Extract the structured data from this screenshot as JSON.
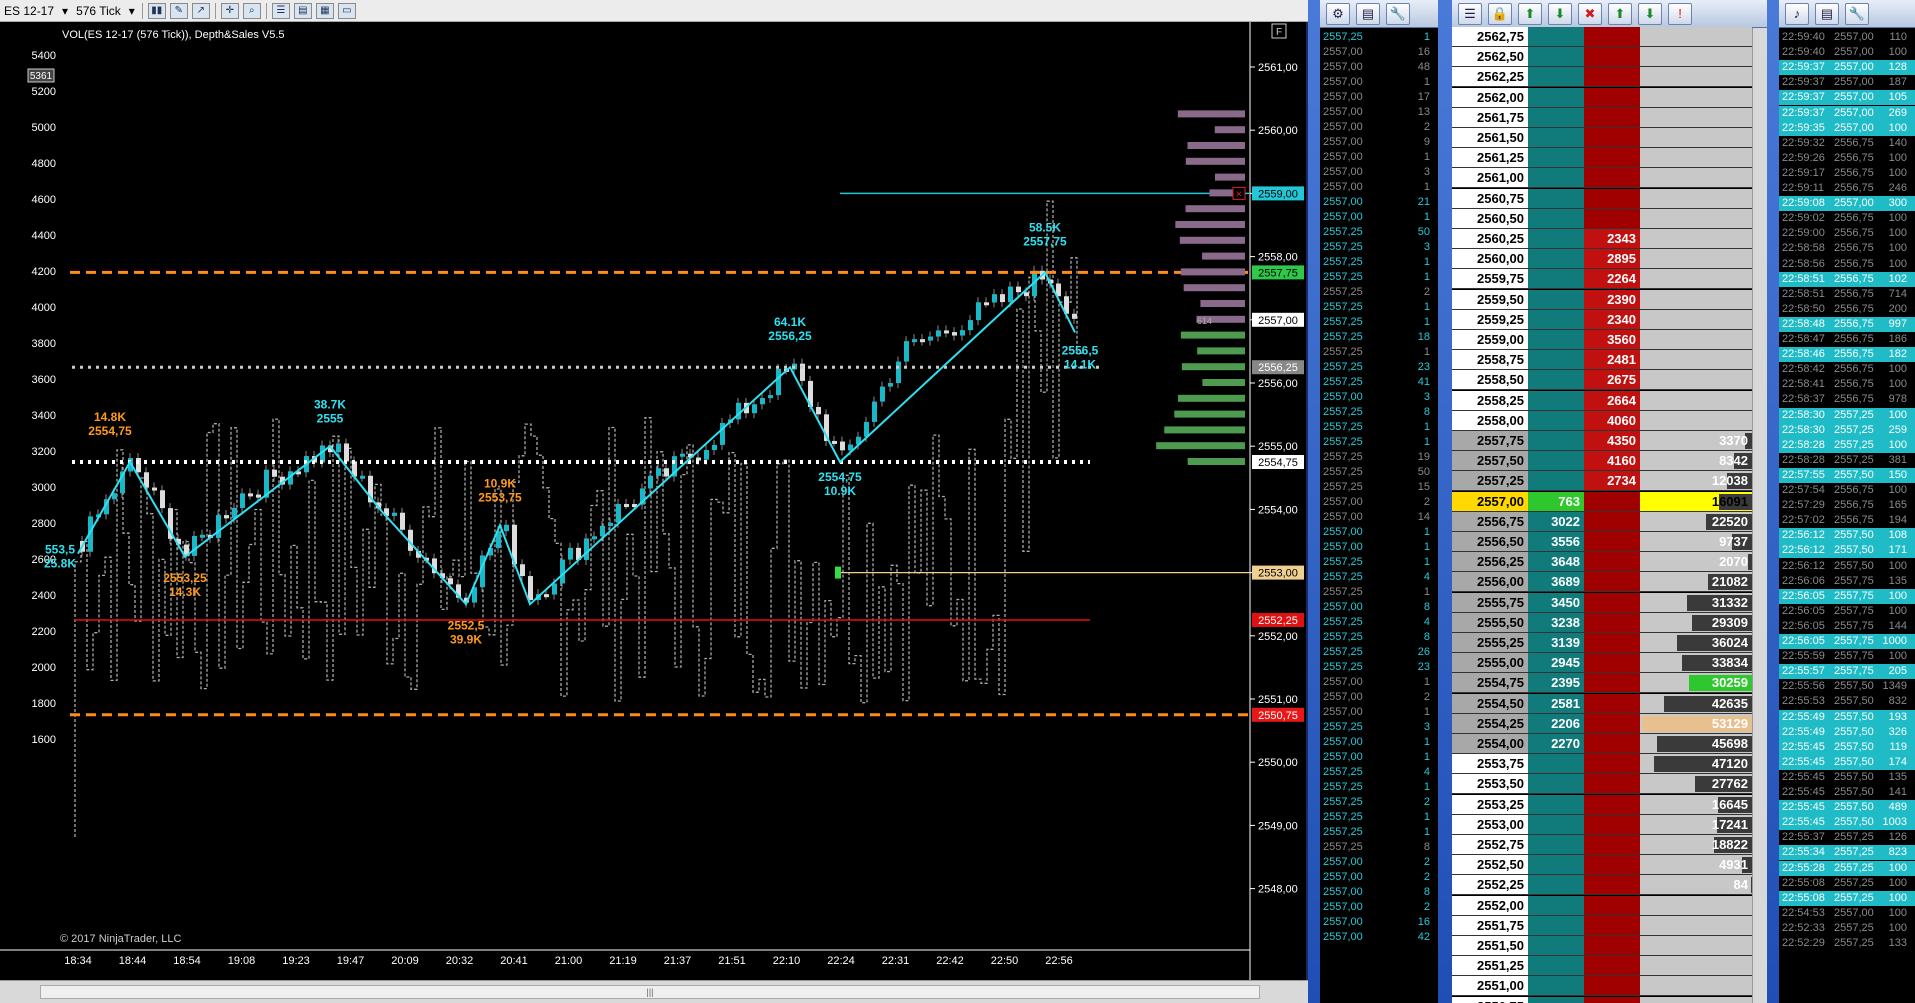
{
  "toolbar": {
    "instrument": "ES 12-17",
    "period": "576 Tick"
  },
  "chart": {
    "title": "VOL(ES 12-17 (576 Tick)), Depth&Sales V5.5",
    "copyright": "© 2017 NinjaTrader, LLC",
    "volume_badge": "5361",
    "vol_ticks": [
      "5400",
      "5200",
      "5000",
      "4800",
      "4600",
      "4400",
      "4200",
      "4000",
      "3800",
      "3600",
      "3400",
      "3200",
      "3000",
      "2800",
      "2600",
      "2400",
      "2200",
      "2000",
      "1800",
      "1600"
    ],
    "price_ticks": [
      "2561,00",
      "2560,00",
      "2559,00",
      "2558,00",
      "2557,00",
      "2556,00",
      "2555,00",
      "2554,00",
      "2553,00",
      "2552,00",
      "2551,00",
      "2550,00",
      "2549,00",
      "2548,00"
    ],
    "time_ticks": [
      "18:34",
      "18:44",
      "18:54",
      "19:08",
      "19:23",
      "19:47",
      "20:09",
      "20:32",
      "20:41",
      "21:00",
      "21:19",
      "21:37",
      "21:51",
      "22:10",
      "22:24",
      "22:31",
      "22:42",
      "22:50",
      "22:56"
    ],
    "price_markers": [
      {
        "label": "2559,00",
        "color": "#22c8d8",
        "text_color": "#000"
      },
      {
        "label": "2557,75",
        "color": "#2ec84a",
        "text_color": "#000"
      },
      {
        "label": "2557,00",
        "color": "#ffffff",
        "text_color": "#000"
      },
      {
        "label": "2556,25",
        "color": "#888888",
        "text_color": "#fff"
      },
      {
        "label": "2554,75",
        "color": "#ffffff",
        "text_color": "#000"
      },
      {
        "label": "2553,00",
        "color": "#f0d090",
        "text_color": "#000"
      },
      {
        "label": "2552,25",
        "color": "#e01010",
        "text_color": "#fff"
      },
      {
        "label": "2550,75",
        "color": "#e81818",
        "text_color": "#fff"
      }
    ],
    "swing_labels": [
      {
        "volume": "14.8K",
        "price": "2554,75",
        "color": "#ff9a1a"
      },
      {
        "volume": "38.7K",
        "price": "2555",
        "color": "#2ee0f0"
      },
      {
        "volume": "2553,25",
        "price": "14.3K",
        "color": "#ff9a1a"
      },
      {
        "volume": "10.9K",
        "price": "2553,75",
        "color": "#ff9a1a"
      },
      {
        "volume": "2552,5",
        "price": "39.9K",
        "color": "#ff9a1a"
      },
      {
        "volume": "64.1K",
        "price": "2556,25",
        "color": "#2ee0f0"
      },
      {
        "volume": "2554,75",
        "price": "10.9K",
        "color": "#2ee0f0"
      },
      {
        "volume": "58.5K",
        "price": "2557,75",
        "color": "#2ee0f0"
      },
      {
        "volume": "2556,5",
        "price": "14.1K",
        "color": "#2ee0f0"
      },
      {
        "volume": "553,5",
        "price": "25.8K",
        "color": "#2ee0f0"
      }
    ],
    "profile_tag": "614"
  },
  "time_sales": {
    "prices": [
      "2557,25",
      "2557,00",
      "2557,00",
      "2557,00",
      "2557,00",
      "2557,00",
      "2557,00",
      "2557,00",
      "2557,00",
      "2557,00",
      "2557,00",
      "2557,00",
      "2557,00",
      "2557,25",
      "2557,25",
      "2557,25",
      "2557,25",
      "2557,25",
      "2557,25",
      "2557,25",
      "2557,25",
      "2557,25",
      "2557,25",
      "2557,25",
      "2557,00",
      "2557,25",
      "2557,25",
      "2557,25",
      "2557,25",
      "2557,25",
      "2557,25",
      "2557,00",
      "2557,00",
      "2557,00",
      "2557,00",
      "2557,25",
      "2557,25",
      "2557,25",
      "2557,00",
      "2557,25",
      "2557,25",
      "2557,25",
      "2557,25",
      "2557,00",
      "2557,00",
      "2557,00",
      "2557,25",
      "2557,00",
      "2557,00",
      "2557,25",
      "2557,25",
      "2557,25",
      "2557,25",
      "2557,25",
      "2557,25",
      "2557,00",
      "2557,00",
      "2557,00",
      "2557,00",
      "2557,00",
      "2557,00",
      "2557,25",
      "2557,25",
      "2557,00",
      "2557,00",
      "2557,00"
    ],
    "sizes": [
      "1",
      "16",
      "48",
      "1",
      "17",
      "13",
      "2",
      "9",
      "1",
      "3",
      "1",
      "21",
      "1",
      "50",
      "3",
      "1",
      "1",
      "2",
      "1",
      "1",
      "18",
      "1",
      "23",
      "41",
      "3",
      "8",
      "1",
      "1",
      "19",
      "50",
      "15",
      "2",
      "14",
      "1",
      "1",
      "1",
      "4",
      "1",
      "8",
      "4",
      "8",
      "26",
      "23",
      "1",
      "2",
      "1",
      "3",
      "1",
      "1",
      "4",
      "1",
      "2",
      "1",
      "1",
      "8",
      "2",
      "2",
      "8",
      "2",
      "16",
      "42"
    ],
    "buy_flags": [
      1,
      0,
      0,
      0,
      0,
      0,
      0,
      0,
      0,
      0,
      0,
      1,
      1,
      1,
      1,
      1,
      1,
      0,
      1,
      1,
      1,
      0,
      1,
      1,
      1,
      1,
      1,
      1,
      0,
      0,
      0,
      0,
      0,
      1,
      1,
      1,
      1,
      0,
      1,
      1,
      1,
      1,
      1,
      0,
      0,
      0,
      1,
      1,
      1,
      1,
      1,
      1,
      1,
      1,
      0,
      1,
      1,
      1,
      1,
      1,
      1,
      1,
      1,
      0,
      0,
      0
    ]
  },
  "dom": {
    "prices": [
      "2562,75",
      "2562,50",
      "2562,25",
      "2562,00",
      "2561,75",
      "2561,50",
      "2561,25",
      "2561,00",
      "2560,75",
      "2560,50",
      "2560,25",
      "2560,00",
      "2559,75",
      "2559,50",
      "2559,25",
      "2559,00",
      "2558,75",
      "2558,50",
      "2558,25",
      "2558,00",
      "2557,75",
      "2557,50",
      "2557,25",
      "2557,00",
      "2556,75",
      "2556,50",
      "2556,25",
      "2556,00",
      "2555,75",
      "2555,50",
      "2555,25",
      "2555,00",
      "2554,75",
      "2554,50",
      "2554,25",
      "2554,00",
      "2553,75",
      "2553,50",
      "2553,25",
      "2553,00",
      "2552,75",
      "2552,50",
      "2552,25",
      "2552,00",
      "2551,75",
      "2551,50",
      "2551,25",
      "2551,00",
      "2550,75"
    ],
    "bids": [
      "",
      "",
      "",
      "",
      "",
      "",
      "",
      "",
      "",
      "",
      "",
      "",
      "",
      "",
      "",
      "",
      "",
      "",
      "",
      "",
      "",
      "",
      "",
      "763",
      "3022",
      "3556",
      "3648",
      "3689",
      "3450",
      "3238",
      "3139",
      "2945",
      "2395",
      "2581",
      "2206",
      "2270",
      "",
      "",
      "",
      "",
      "",
      "",
      "",
      "",
      "",
      "",
      "",
      "",
      ""
    ],
    "asks": [
      "",
      "",
      "",
      "",
      "",
      "",
      "",
      "",
      "",
      "",
      "2343",
      "2895",
      "2264",
      "2390",
      "2340",
      "3560",
      "2481",
      "2675",
      "2664",
      "4060",
      "4350",
      "4160",
      "2734",
      "",
      "",
      "",
      "",
      "",
      "",
      "",
      "",
      "",
      "",
      "",
      "",
      "",
      "",
      "",
      "",
      "",
      "",
      "",
      "",
      "",
      "",
      "",
      "",
      "",
      ""
    ],
    "volumes": [
      "",
      "",
      "",
      "",
      "",
      "",
      "",
      "",
      "",
      "",
      "",
      "",
      "",
      "",
      "",
      "",
      "",
      "",
      "",
      "",
      "3370",
      "8342",
      "12038",
      "16091",
      "22520",
      "9737",
      "2070",
      "21082",
      "31332",
      "29309",
      "36024",
      "33834",
      "30259",
      "42635",
      "53129",
      "45698",
      "47120",
      "27762",
      "16645",
      "17241",
      "18822",
      "4931",
      "84",
      "",
      "",
      "",
      "",
      "",
      ""
    ],
    "vol_fracs": [
      0,
      0,
      0,
      0,
      0,
      0,
      0,
      0,
      0,
      0,
      0,
      0,
      0,
      0,
      0,
      0,
      0,
      0,
      0,
      0,
      0.06,
      0.16,
      0.23,
      0.3,
      0.42,
      0.18,
      0.04,
      0.4,
      0.59,
      0.55,
      0.68,
      0.64,
      0.57,
      0.8,
      1.0,
      0.86,
      0.89,
      0.52,
      0.31,
      0.32,
      0.35,
      0.09,
      0.01,
      0,
      0,
      0,
      0,
      0,
      0
    ],
    "last_price": "2557,00",
    "last_volume": "16091"
  },
  "sales_log": {
    "times": [
      "22:59:40",
      "22:59:40",
      "22:59:37",
      "22:59:37",
      "22:59:37",
      "22:59:37",
      "22:59:35",
      "22:59:32",
      "22:59:26",
      "22:59:17",
      "22:59:11",
      "22:59:08",
      "22:59:02",
      "22:59:00",
      "22:58:58",
      "22:58:56",
      "22:58:51",
      "22:58:51",
      "22:58:50",
      "22:58:48",
      "22:58:47",
      "22:58:46",
      "22:58:42",
      "22:58:41",
      "22:58:37",
      "22:58:30",
      "22:58:30",
      "22:58:28",
      "22:58:28",
      "22:57:55",
      "22:57:54",
      "22:57:29",
      "22:57:02",
      "22:56:12",
      "22:56:12",
      "22:56:12",
      "22:56:06",
      "22:56:05",
      "22:56:05",
      "22:56:05",
      "22:56:05",
      "22:55:59",
      "22:55:57",
      "22:55:56",
      "22:55:53",
      "22:55:49",
      "22:55:49",
      "22:55:45",
      "22:55:45",
      "22:55:45",
      "22:55:45",
      "22:55:45",
      "22:55:45",
      "22:55:37",
      "22:55:34",
      "22:55:28",
      "22:55:08",
      "22:55:08",
      "22:54:53",
      "22:52:33",
      "22:52:29"
    ],
    "prices": [
      "2557,00",
      "2557,00",
      "2557,00",
      "2557,00",
      "2557,00",
      "2557,00",
      "2557,00",
      "2556,75",
      "2556,75",
      "2556,75",
      "2556,75",
      "2557,00",
      "2556,75",
      "2556,75",
      "2556,75",
      "2556,75",
      "2556,75",
      "2556,75",
      "2556,75",
      "2556,75",
      "2556,75",
      "2556,75",
      "2556,75",
      "2556,75",
      "2556,75",
      "2557,25",
      "2557,25",
      "2557,25",
      "2557,25",
      "2557,50",
      "2556,75",
      "2556,75",
      "2556,75",
      "2557,50",
      "2557,50",
      "2557,50",
      "2557,75",
      "2557,75",
      "2557,75",
      "2557,75",
      "2557,75",
      "2557,75",
      "2557,75",
      "2557,50",
      "2557,50",
      "2557,50",
      "2557,50",
      "2557,50",
      "2557,50",
      "2557,50",
      "2557,50",
      "2557,50",
      "2557,50",
      "2557,25",
      "2557,25",
      "2557,25",
      "2557,25",
      "2557,25",
      "2557,00",
      "2557,25",
      "2557,25"
    ],
    "sizes": [
      "110",
      "100",
      "128",
      "187",
      "105",
      "269",
      "100",
      "140",
      "100",
      "100",
      "246",
      "300",
      "100",
      "100",
      "100",
      "100",
      "102",
      "714",
      "200",
      "997",
      "186",
      "182",
      "100",
      "100",
      "978",
      "100",
      "259",
      "100",
      "381",
      "150",
      "100",
      "165",
      "194",
      "108",
      "171",
      "100",
      "135",
      "100",
      "100",
      "144",
      "1000",
      "100",
      "205",
      "1349",
      "832",
      "193",
      "326",
      "119",
      "174",
      "135",
      "141",
      "489",
      "1003",
      "126",
      "823",
      "100",
      "100",
      "100",
      "100",
      "100",
      "133"
    ],
    "buy_flags": [
      0,
      0,
      1,
      0,
      1,
      1,
      1,
      0,
      0,
      0,
      0,
      1,
      0,
      0,
      0,
      0,
      1,
      0,
      0,
      1,
      0,
      1,
      0,
      0,
      0,
      1,
      1,
      1,
      0,
      1,
      0,
      0,
      0,
      1,
      1,
      0,
      0,
      1,
      0,
      0,
      1,
      0,
      1,
      0,
      0,
      1,
      1,
      1,
      1,
      0,
      0,
      1,
      1,
      0,
      1,
      1,
      0,
      1,
      0,
      0,
      0
    ]
  },
  "icons": {
    "toolbar": [
      "bar-type-icon",
      "draw-icon",
      "indicator-icon",
      "crosshair-icon",
      "zoom-icon",
      "properties-icon",
      "data-box-icon",
      "chart-trader-icon",
      "template-icon"
    ],
    "ts_panel": [
      "settings-icon",
      "filter-icon",
      "wrench-icon"
    ],
    "dom_panel": [
      "ladder-icon",
      "lock-icon",
      "center-up-icon",
      "center-down-icon",
      "clear-icon",
      "up-arrow-icon",
      "down-arrow-icon",
      "alert-icon"
    ],
    "log_panel": [
      "sound-icon",
      "filter-icon",
      "wrench-icon"
    ]
  }
}
